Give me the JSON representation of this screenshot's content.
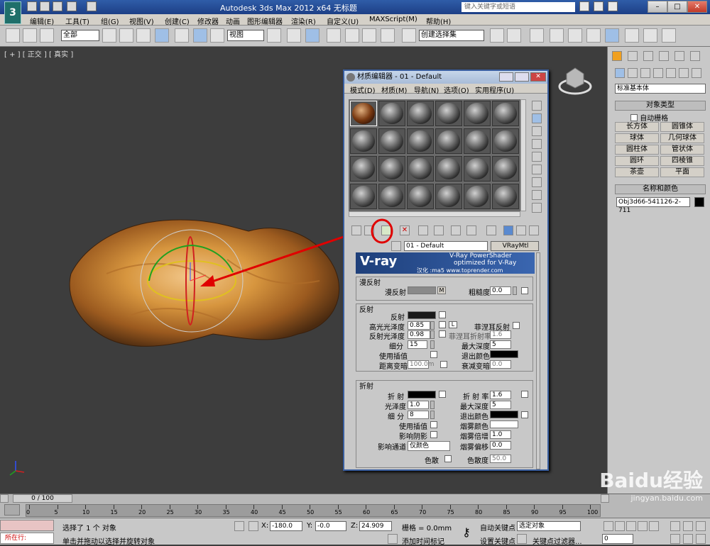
{
  "titlebar": {
    "app_title": "Autodesk 3ds Max  2012 x64    无标题",
    "search_placeholder": "键入关键字或短语",
    "logo": "3"
  },
  "menubar": {
    "items": [
      "编辑(E)",
      "工具(T)",
      "组(G)",
      "视图(V)",
      "创建(C)",
      "修改器",
      "动画",
      "图形编辑器",
      "渲染(R)",
      "自定义(U)",
      "MAXScript(M)",
      "帮助(H)"
    ]
  },
  "toolbar": {
    "filter_value": "全部",
    "refcoord_value": "视图",
    "selection_set": "创建选择集"
  },
  "viewport": {
    "label": "[ + ] [ 正交 ] [ 真实 ]"
  },
  "command_panel": {
    "category_dropdown": "标准基本体",
    "object_type_header": "对象类型",
    "autogrid_label": "自动栅格",
    "buttons": [
      "长方体",
      "圆锥体",
      "球体",
      "几何球体",
      "圆柱体",
      "管状体",
      "圆环",
      "四棱锥",
      "茶壶",
      "平面"
    ],
    "name_color_header": "名称和颜色",
    "object_name": "Obj3d66-541126-2-711"
  },
  "material_editor": {
    "title": "材质编辑器 - 01 - Default",
    "menu": [
      "模式(D)",
      "材质(M)",
      "导航(N)",
      "选项(O)",
      "实用程序(U)"
    ],
    "material_name": "01 - Default",
    "material_type": "VRayMtl",
    "banner": {
      "brand": "V-ray",
      "line1": "V-Ray PowerShader",
      "line2": "optimized for V-Ray",
      "credit": "汉化 :ma5 www.toprender.com"
    },
    "diffuse": {
      "group_label": "漫反射",
      "diffuse_label": "漫反射",
      "m_button": "M",
      "roughness_label": "粗糙度",
      "roughness_value": "0.0"
    },
    "reflection": {
      "group_label": "反射",
      "reflect_label": "反射",
      "hilight_gloss_label": "高光光泽度",
      "hilight_gloss_value": "0.85",
      "lock_label": "L",
      "fresnel_label": "菲涅耳反射",
      "refl_gloss_label": "反射光泽度",
      "refl_gloss_value": "0.98",
      "fresnel_ior_label": "菲涅耳折射率",
      "fresnel_ior_value": "1.6",
      "subdivs_label": "细分",
      "subdivs_value": "15",
      "max_depth_label": "最大深度",
      "max_depth_value": "5",
      "use_interp_label": "使用插值",
      "exit_color_label": "退出颜色",
      "dim_dist_label": "距离变暗",
      "dim_dist_value": "100.0m",
      "dim_falloff_label": "衰减变暗",
      "dim_falloff_value": "0.0"
    },
    "refraction": {
      "group_label": "折射",
      "refract_label": "折 射",
      "ior_label": "折 射 率",
      "ior_value": "1.6",
      "gloss_label": "光泽度",
      "gloss_value": "1.0",
      "max_depth_label": "最大深度",
      "max_depth_value": "5",
      "subdivs_label": "细 分",
      "subdivs_value": "8",
      "exit_color_label": "退出颜色",
      "use_interp_label": "使用插值",
      "fog_color_label": "烟雾颜色",
      "affect_shadows_label": "影响阴影",
      "fog_mult_label": "烟雾倍增",
      "fog_mult_value": "1.0",
      "affect_channels_label": "影响通道",
      "affect_channels_value": "仅颜色",
      "fog_bias_label": "烟雾偏移",
      "fog_bias_value": "0.0",
      "dispersion_label": "色散",
      "abbe_label": "色散度",
      "abbe_value": "50.0"
    }
  },
  "timeline": {
    "frame_counter": "0 / 100",
    "ticks": [
      "0",
      "5",
      "10",
      "15",
      "20",
      "25",
      "30",
      "35",
      "40",
      "45",
      "50",
      "55",
      "60",
      "65",
      "70",
      "75",
      "80",
      "85",
      "90",
      "95",
      "100"
    ]
  },
  "status": {
    "selected_text": "选择了 1 个 对象",
    "prompt_text": "单击并拖动以选择并旋转对象",
    "running_label": "所在行:",
    "x_label": "X:",
    "x_value": "-180.0",
    "y_label": "Y:",
    "y_value": "-0.0",
    "z_label": "Z:",
    "z_value": "24.909",
    "grid_label": "栅格 = 0.0mm",
    "add_time_tag": "添加时间标记",
    "auto_key": "自动关键点",
    "set_key": "设置关键点",
    "selected_object_dropdown": "选定对象",
    "key_filters": "关键点过滤器...",
    "frame_field": "0"
  },
  "watermark": {
    "brand": "Baidu经验",
    "url": "jingyan.baidu.com"
  }
}
